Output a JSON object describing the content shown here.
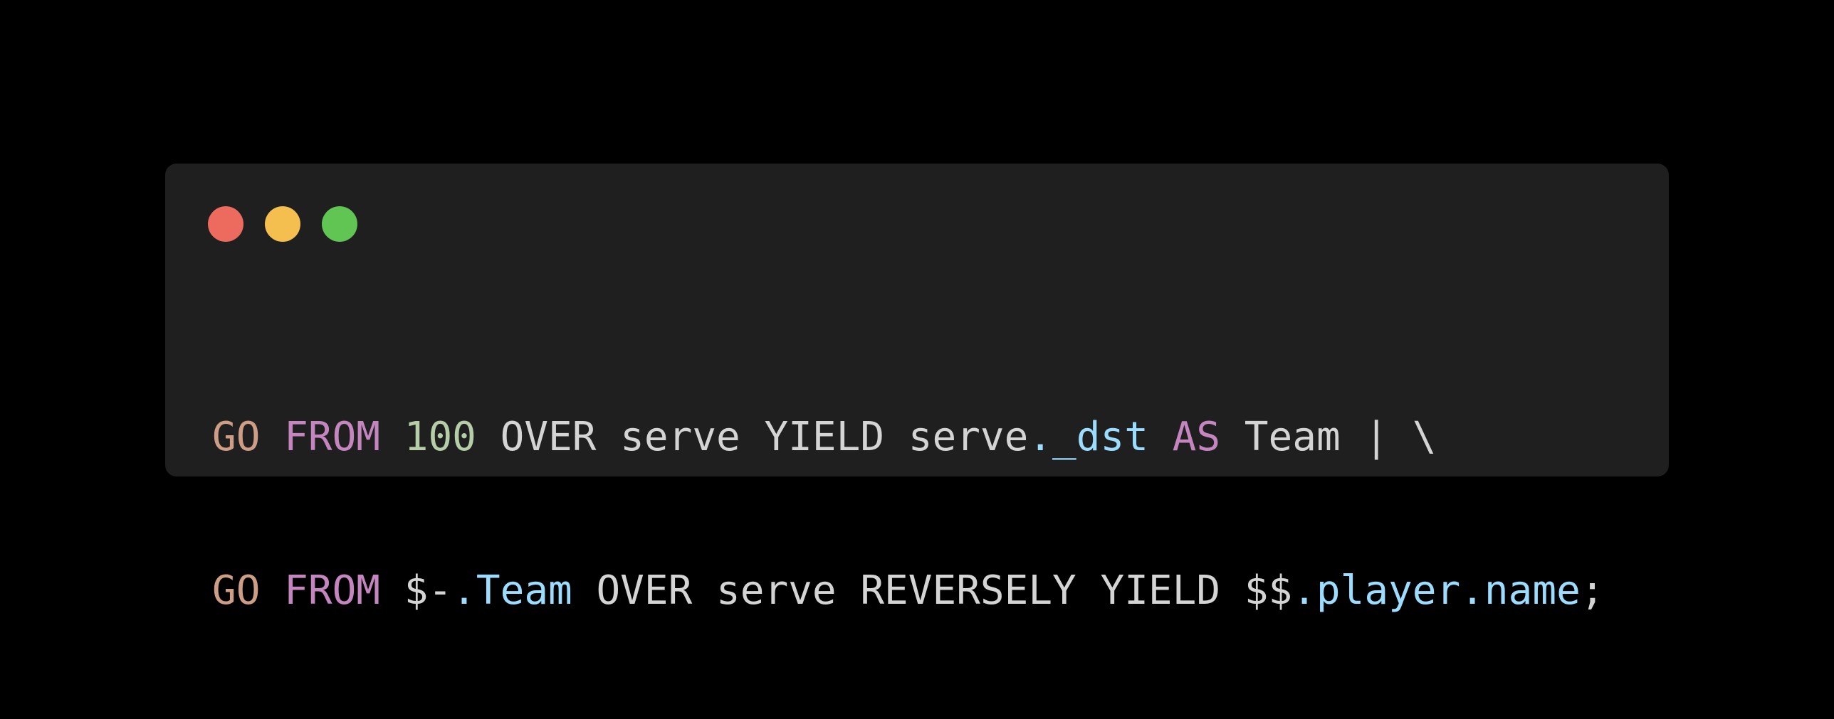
{
  "window": {
    "controls": [
      {
        "name": "close-dot",
        "color": "#ed6a5e"
      },
      {
        "name": "minimize-dot",
        "color": "#f5bf4f"
      },
      {
        "name": "maximize-dot",
        "color": "#61c554"
      }
    ]
  },
  "colors": {
    "background": "#000000",
    "window": "#1f1f1f",
    "plain": "#d4d4d4",
    "go": "#ce9d86",
    "keyword": "#c586c0",
    "number": "#b5cea8",
    "property": "#9cdcfe"
  },
  "code": {
    "lines": [
      {
        "tokens": [
          {
            "text": "GO",
            "kind": "go"
          },
          {
            "text": " ",
            "kind": "plain"
          },
          {
            "text": "FROM",
            "kind": "keyword"
          },
          {
            "text": " ",
            "kind": "plain"
          },
          {
            "text": "100",
            "kind": "number"
          },
          {
            "text": " OVER serve YIELD serve",
            "kind": "plain"
          },
          {
            "text": "._dst",
            "kind": "property"
          },
          {
            "text": " ",
            "kind": "plain"
          },
          {
            "text": "AS",
            "kind": "keyword"
          },
          {
            "text": " Team | \\",
            "kind": "plain"
          }
        ]
      },
      {
        "tokens": [
          {
            "text": "GO",
            "kind": "go"
          },
          {
            "text": " ",
            "kind": "plain"
          },
          {
            "text": "FROM",
            "kind": "keyword"
          },
          {
            "text": " $-",
            "kind": "plain"
          },
          {
            "text": ".Team",
            "kind": "property"
          },
          {
            "text": " OVER serve REVERSELY YIELD $$",
            "kind": "plain"
          },
          {
            "text": ".player.name",
            "kind": "property"
          },
          {
            "text": ";",
            "kind": "plain"
          }
        ]
      }
    ]
  }
}
